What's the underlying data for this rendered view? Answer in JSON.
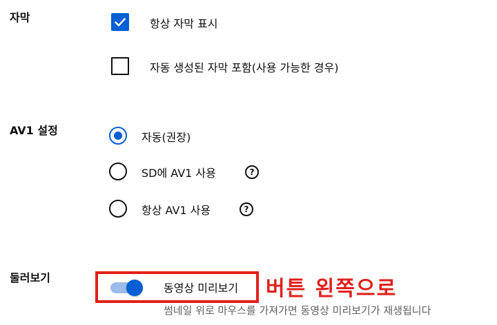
{
  "captions": {
    "label": "자막",
    "always_show": {
      "label": "항상 자막 표시",
      "checked": true
    },
    "auto_generated": {
      "label": "자동 생성된 자막 포함(사용 가능한 경우)",
      "checked": false
    }
  },
  "av1": {
    "label": "AV1 설정",
    "options": [
      {
        "label": "자동(권장)",
        "selected": true
      },
      {
        "label": "SD에 AV1 사용",
        "selected": false
      },
      {
        "label": "항상 AV1 사용",
        "selected": false
      }
    ],
    "help_glyph": "?"
  },
  "browse": {
    "label": "둘러보기",
    "preview_toggle": {
      "label": "동영상 미리보기",
      "on": true
    },
    "description": "썸네일 위로 마우스를 가져가면 동영상 미리보기가 재생됩니다"
  },
  "annotation": {
    "text": "버튼 왼쪽으로",
    "color": "#e0201b"
  },
  "colors": {
    "accent": "#065fd4",
    "toggle_track": "#9bbbe8"
  }
}
